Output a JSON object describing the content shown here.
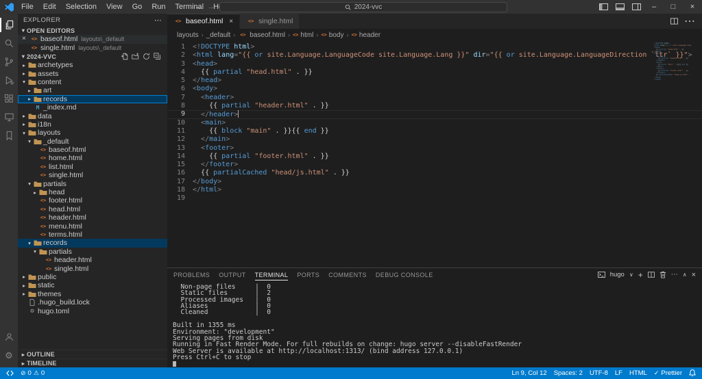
{
  "titlebar": {
    "menus": [
      "File",
      "Edit",
      "Selection",
      "View",
      "Go",
      "Run",
      "Terminal",
      "Help"
    ],
    "search_value": "2024-vvc",
    "window_controls": {
      "minimize": "–",
      "maximize": "□",
      "close": "×"
    }
  },
  "activity_bar": [
    {
      "name": "explorer",
      "active": true
    },
    {
      "name": "search",
      "active": false
    },
    {
      "name": "source-control",
      "active": false
    },
    {
      "name": "run-and-debug",
      "active": false
    },
    {
      "name": "extensions",
      "active": false
    },
    {
      "name": "remote-explorer",
      "active": false
    },
    {
      "name": "bookmarks",
      "active": false
    }
  ],
  "sidebar": {
    "title": "EXPLORER",
    "open_editors": {
      "header": "OPEN EDITORS",
      "items": [
        {
          "label": "baseof.html",
          "desc": "layouts\\_default",
          "icon": "html",
          "closable": true,
          "active": true
        },
        {
          "label": "single.html",
          "desc": "layouts\\_default",
          "icon": "html",
          "closable": false,
          "active": false
        }
      ]
    },
    "project": {
      "header": "2024-VVC",
      "tree": [
        {
          "label": "archetypes",
          "level": 0,
          "kind": "folder",
          "state": "collapsed"
        },
        {
          "label": "assets",
          "level": 0,
          "kind": "folder",
          "state": "collapsed"
        },
        {
          "label": "content",
          "level": 0,
          "kind": "folder",
          "state": "expanded"
        },
        {
          "label": "art",
          "level": 1,
          "kind": "folder",
          "state": "collapsed"
        },
        {
          "label": "records",
          "level": 1,
          "kind": "folder",
          "state": "collapsed",
          "selected": "focused"
        },
        {
          "label": "_index.md",
          "level": 1,
          "kind": "file",
          "icon": "md"
        },
        {
          "label": "data",
          "level": 0,
          "kind": "folder",
          "state": "collapsed"
        },
        {
          "label": "i18n",
          "level": 0,
          "kind": "folder",
          "state": "collapsed"
        },
        {
          "label": "layouts",
          "level": 0,
          "kind": "folder",
          "state": "expanded"
        },
        {
          "label": "_default",
          "level": 1,
          "kind": "folder",
          "state": "expanded"
        },
        {
          "label": "baseof.html",
          "level": 2,
          "kind": "file",
          "icon": "html"
        },
        {
          "label": "home.html",
          "level": 2,
          "kind": "file",
          "icon": "html"
        },
        {
          "label": "list.html",
          "level": 2,
          "kind": "file",
          "icon": "html"
        },
        {
          "label": "single.html",
          "level": 2,
          "kind": "file",
          "icon": "html"
        },
        {
          "label": "partials",
          "level": 1,
          "kind": "folder",
          "state": "expanded"
        },
        {
          "label": "head",
          "level": 2,
          "kind": "folder",
          "state": "collapsed"
        },
        {
          "label": "footer.html",
          "level": 2,
          "kind": "file",
          "icon": "html"
        },
        {
          "label": "head.html",
          "level": 2,
          "kind": "file",
          "icon": "html"
        },
        {
          "label": "header.html",
          "level": 2,
          "kind": "file",
          "icon": "html"
        },
        {
          "label": "menu.html",
          "level": 2,
          "kind": "file",
          "icon": "html"
        },
        {
          "label": "terms.html",
          "level": 2,
          "kind": "file",
          "icon": "html"
        },
        {
          "label": "records",
          "level": 1,
          "kind": "folder",
          "state": "expanded",
          "selected": "selected"
        },
        {
          "label": "partials",
          "level": 2,
          "kind": "folder",
          "state": "expanded"
        },
        {
          "label": "header.html",
          "level": 3,
          "kind": "file",
          "icon": "html"
        },
        {
          "label": "single.html",
          "level": 3,
          "kind": "file",
          "icon": "html"
        },
        {
          "label": "public",
          "level": 0,
          "kind": "folder",
          "state": "collapsed"
        },
        {
          "label": "static",
          "level": 0,
          "kind": "folder",
          "state": "collapsed"
        },
        {
          "label": "themes",
          "level": 0,
          "kind": "folder",
          "state": "collapsed"
        },
        {
          "label": ".hugo_build.lock",
          "level": 0,
          "kind": "file",
          "icon": "lock"
        },
        {
          "label": "hugo.toml",
          "level": 0,
          "kind": "file",
          "icon": "toml"
        }
      ]
    },
    "bottom_sections": [
      "OUTLINE",
      "TIMELINE"
    ]
  },
  "editor": {
    "tabs": [
      {
        "label": "baseof.html",
        "icon": "html",
        "active": true,
        "closable": true
      },
      {
        "label": "single.html",
        "icon": "html",
        "active": false,
        "closable": false
      }
    ],
    "breadcrumbs": [
      {
        "label": "layouts",
        "icon": null
      },
      {
        "label": "_default",
        "icon": null
      },
      {
        "label": "baseof.html",
        "icon": "html"
      },
      {
        "label": "html",
        "icon": "symbol"
      },
      {
        "label": "body",
        "icon": "symbol"
      },
      {
        "label": "header",
        "icon": "symbol"
      }
    ],
    "code": {
      "cursor": {
        "line": 9,
        "col": 12
      },
      "lines": [
        [
          [
            "p",
            "<!"
          ],
          [
            "t",
            "DOCTYPE"
          ],
          [
            "w",
            " "
          ],
          [
            "a",
            "html"
          ],
          [
            "p",
            ">"
          ]
        ],
        [
          [
            "p",
            "<"
          ],
          [
            "t",
            "html"
          ],
          [
            "w",
            " "
          ],
          [
            "a",
            "lang"
          ],
          [
            "p",
            "="
          ],
          [
            "s",
            "\"{{ "
          ],
          [
            "k",
            "or"
          ],
          [
            "s",
            " site.Language.LanguageCode site.Language.Lang }}\""
          ],
          [
            "w",
            " "
          ],
          [
            "a",
            "dir"
          ],
          [
            "p",
            "="
          ],
          [
            "s",
            "\"{{ "
          ],
          [
            "k",
            "or"
          ],
          [
            "s",
            " site.Language.LanguageDirection `ltr` }}\""
          ],
          [
            "p",
            ">"
          ]
        ],
        [
          [
            "p",
            "<"
          ],
          [
            "t",
            "head"
          ],
          [
            "p",
            ">"
          ]
        ],
        [
          [
            "w",
            "  "
          ],
          [
            "w",
            "{{ "
          ],
          [
            "k",
            "partial"
          ],
          [
            "w",
            " "
          ],
          [
            "s",
            "\"head.html\""
          ],
          [
            "w",
            " . }}"
          ]
        ],
        [
          [
            "p",
            "</"
          ],
          [
            "t",
            "head"
          ],
          [
            "p",
            ">"
          ]
        ],
        [
          [
            "p",
            "<"
          ],
          [
            "t",
            "body"
          ],
          [
            "p",
            ">"
          ]
        ],
        [
          [
            "w",
            "  "
          ],
          [
            "p",
            "<"
          ],
          [
            "t",
            "header"
          ],
          [
            "p",
            ">"
          ]
        ],
        [
          [
            "w",
            "    "
          ],
          [
            "w",
            "{{ "
          ],
          [
            "k",
            "partial"
          ],
          [
            "w",
            " "
          ],
          [
            "s",
            "\"header.html\""
          ],
          [
            "w",
            " . }}"
          ]
        ],
        [
          [
            "w",
            "  "
          ],
          [
            "p",
            "</"
          ],
          [
            "t",
            "header"
          ],
          [
            "p",
            ">"
          ]
        ],
        [
          [
            "w",
            "  "
          ],
          [
            "p",
            "<"
          ],
          [
            "t",
            "main"
          ],
          [
            "p",
            ">"
          ]
        ],
        [
          [
            "w",
            "    "
          ],
          [
            "w",
            "{{ "
          ],
          [
            "k",
            "block"
          ],
          [
            "w",
            " "
          ],
          [
            "s",
            "\"main\""
          ],
          [
            "w",
            " . }}"
          ],
          [
            "w",
            "{{ "
          ],
          [
            "k",
            "end"
          ],
          [
            "w",
            " }}"
          ]
        ],
        [
          [
            "w",
            "  "
          ],
          [
            "p",
            "</"
          ],
          [
            "t",
            "main"
          ],
          [
            "p",
            ">"
          ]
        ],
        [
          [
            "w",
            "  "
          ],
          [
            "p",
            "<"
          ],
          [
            "t",
            "footer"
          ],
          [
            "p",
            ">"
          ]
        ],
        [
          [
            "w",
            "    "
          ],
          [
            "w",
            "{{ "
          ],
          [
            "k",
            "partial"
          ],
          [
            "w",
            " "
          ],
          [
            "s",
            "\"footer.html\""
          ],
          [
            "w",
            " . }}"
          ]
        ],
        [
          [
            "w",
            "  "
          ],
          [
            "p",
            "</"
          ],
          [
            "t",
            "footer"
          ],
          [
            "p",
            ">"
          ]
        ],
        [
          [
            "w",
            "  "
          ],
          [
            "w",
            "{{ "
          ],
          [
            "k",
            "partialCached"
          ],
          [
            "w",
            " "
          ],
          [
            "s",
            "\"head/js.html\""
          ],
          [
            "w",
            " . }}"
          ]
        ],
        [
          [
            "p",
            "</"
          ],
          [
            "t",
            "body"
          ],
          [
            "p",
            ">"
          ]
        ],
        [
          [
            "p",
            "</"
          ],
          [
            "t",
            "html"
          ],
          [
            "p",
            ">"
          ]
        ],
        []
      ]
    }
  },
  "panel": {
    "tabs": [
      {
        "label": "PROBLEMS",
        "active": false
      },
      {
        "label": "OUTPUT",
        "active": false
      },
      {
        "label": "TERMINAL",
        "active": true
      },
      {
        "label": "PORTS",
        "active": false
      },
      {
        "label": "COMMENTS",
        "active": false
      },
      {
        "label": "DEBUG CONSOLE",
        "active": false
      }
    ],
    "shell_name": "hugo",
    "terminal_lines": [
      "  Non-page files     |  0",
      "  Static files       |  2",
      "  Processed images   |  0",
      "  Aliases            |  0",
      "  Cleaned            |  0",
      "",
      "Built in 1355 ms",
      "Environment: \"development\"",
      "Serving pages from disk",
      "Running in Fast Render Mode. For full rebuilds on change: hugo server --disableFastRender",
      "Web Server is available at http://localhost:1313/ (bind address 127.0.0.1)",
      "Press Ctrl+C to stop"
    ],
    "cursor": true
  },
  "status_bar": {
    "errors": "0",
    "warnings": "0",
    "items_right": [
      {
        "name": "cursor-position",
        "label": "Ln 9, Col 12"
      },
      {
        "name": "indentation",
        "label": "Spaces: 2"
      },
      {
        "name": "encoding",
        "label": "UTF-8"
      },
      {
        "name": "eol",
        "label": "LF"
      },
      {
        "name": "language-mode",
        "label": "HTML"
      },
      {
        "name": "formatter",
        "label": "Prettier",
        "check": true
      }
    ]
  }
}
